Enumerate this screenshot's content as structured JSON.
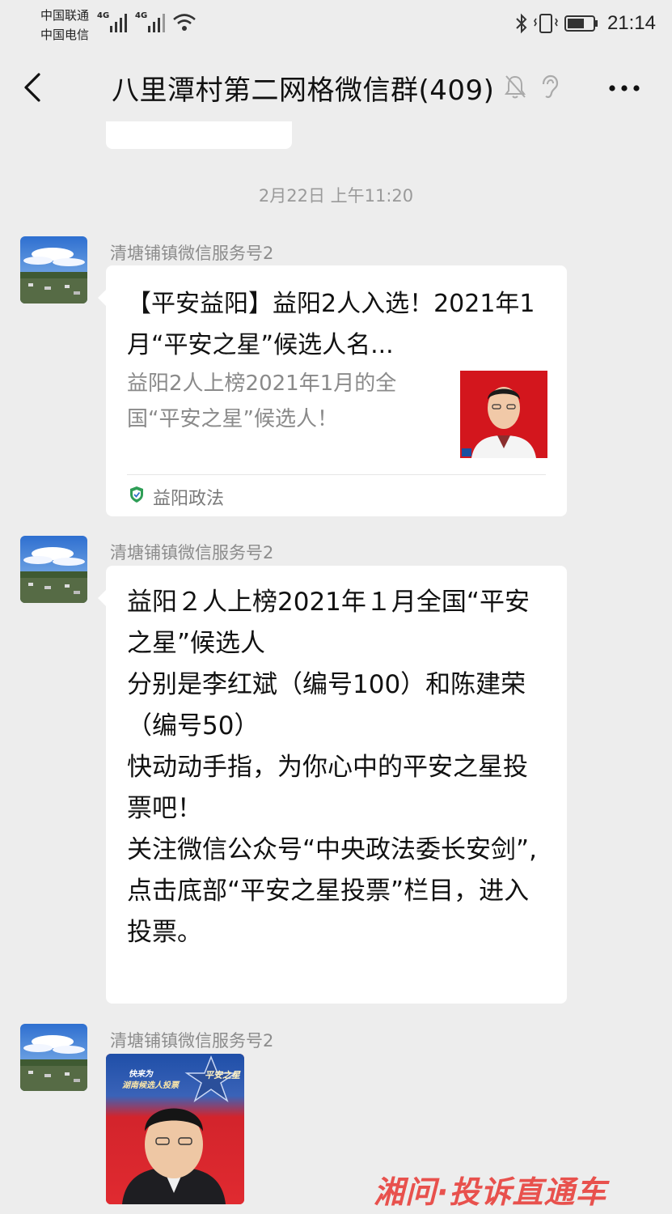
{
  "status_bar": {
    "carrier_1": "中国联通",
    "carrier_2": "中国电信",
    "network_1": "4G",
    "network_2": "4G",
    "time": "21:14",
    "icons": [
      "signal-icon",
      "wifi-icon",
      "bluetooth-icon",
      "vibrate-icon",
      "battery-icon"
    ]
  },
  "header": {
    "title": "八里潭村第二网格微信群(409)",
    "icons": [
      "back-icon",
      "mute-icon",
      "ear-icon",
      "more-icon"
    ]
  },
  "chat": {
    "timestamp": "2月22日 上午11:20",
    "messages": [
      {
        "sender": "清塘铺镇微信服务号2",
        "type": "link-card",
        "title": "【平安益阳】益阳2人入选！2021年1月“平安之星”候选人名...",
        "description": "益阳2人上榜2021年1月的全国“平安之星”候选人！",
        "source": "益阳政法"
      },
      {
        "sender": "清塘铺镇微信服务号2",
        "type": "text",
        "text": "益阳２人上榜2021年１月全国“平安之星”候选人\n分别是李红斌（编号100）和陈建荣（编号50）\n快动动手指，为你心中的平安之星投票吧！\n关注微信公众号“中央政法委长安剑”,\n点击底部“平安之星投票”栏目，进入投票。"
      },
      {
        "sender": "清塘铺镇微信服务号2",
        "type": "image",
        "caption_1": "快来为",
        "caption_2": "湖南候选人投票",
        "badge": "平安之星"
      }
    ]
  },
  "watermark": "湘问·投诉直通车",
  "colors": {
    "background": "#ededed",
    "bubble": "#ffffff",
    "poster_red": "#d91f2a",
    "watermark": "#e8413c"
  }
}
